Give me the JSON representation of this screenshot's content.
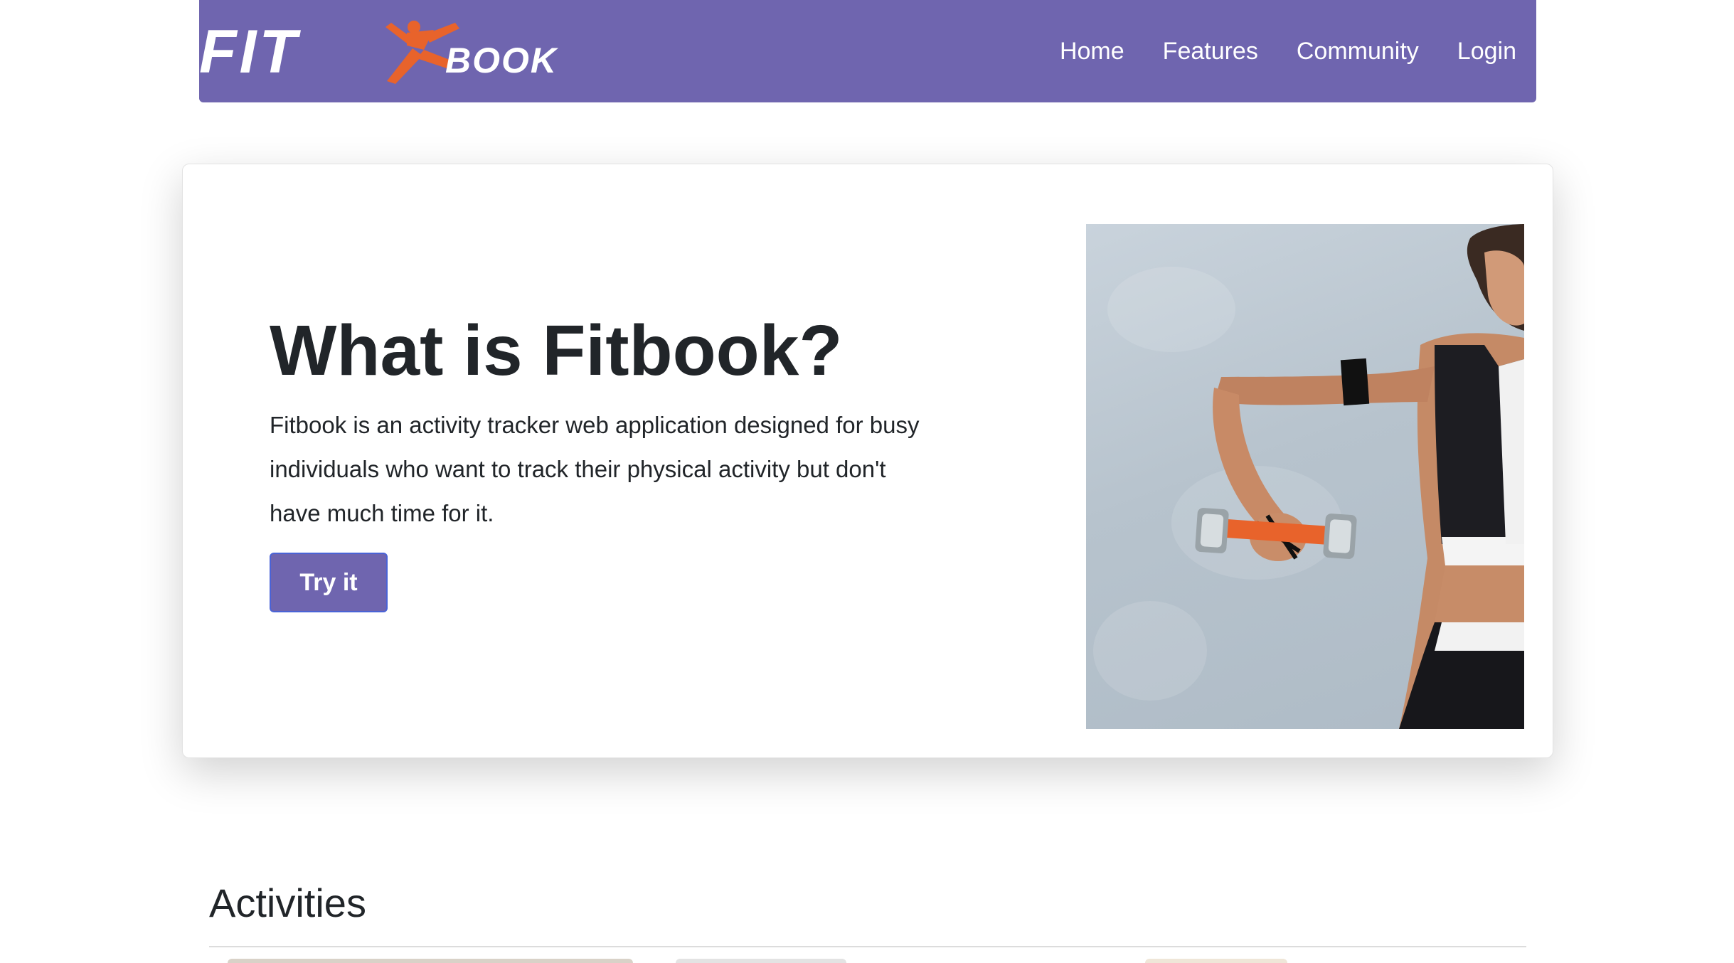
{
  "brand": {
    "logo_text_fit": "FIT",
    "logo_text_book": "BOOK",
    "logo_colors": {
      "text": "#ffffff",
      "runner": "#e8632b"
    }
  },
  "navbar": {
    "background": "#6f65af",
    "links": [
      {
        "label": "Home"
      },
      {
        "label": "Features"
      },
      {
        "label": "Community"
      },
      {
        "label": "Login"
      }
    ]
  },
  "hero": {
    "title": "What is Fitbook?",
    "description": "Fitbook is an activity tracker web application designed for busy individuals who want to track their physical activity but don't have much time for it.",
    "cta_label": "Try it",
    "image_icon": "woman-dumbbell-photo"
  },
  "activities": {
    "title": "Activities"
  },
  "colors": {
    "accent": "#6f65af",
    "text": "#212529"
  }
}
